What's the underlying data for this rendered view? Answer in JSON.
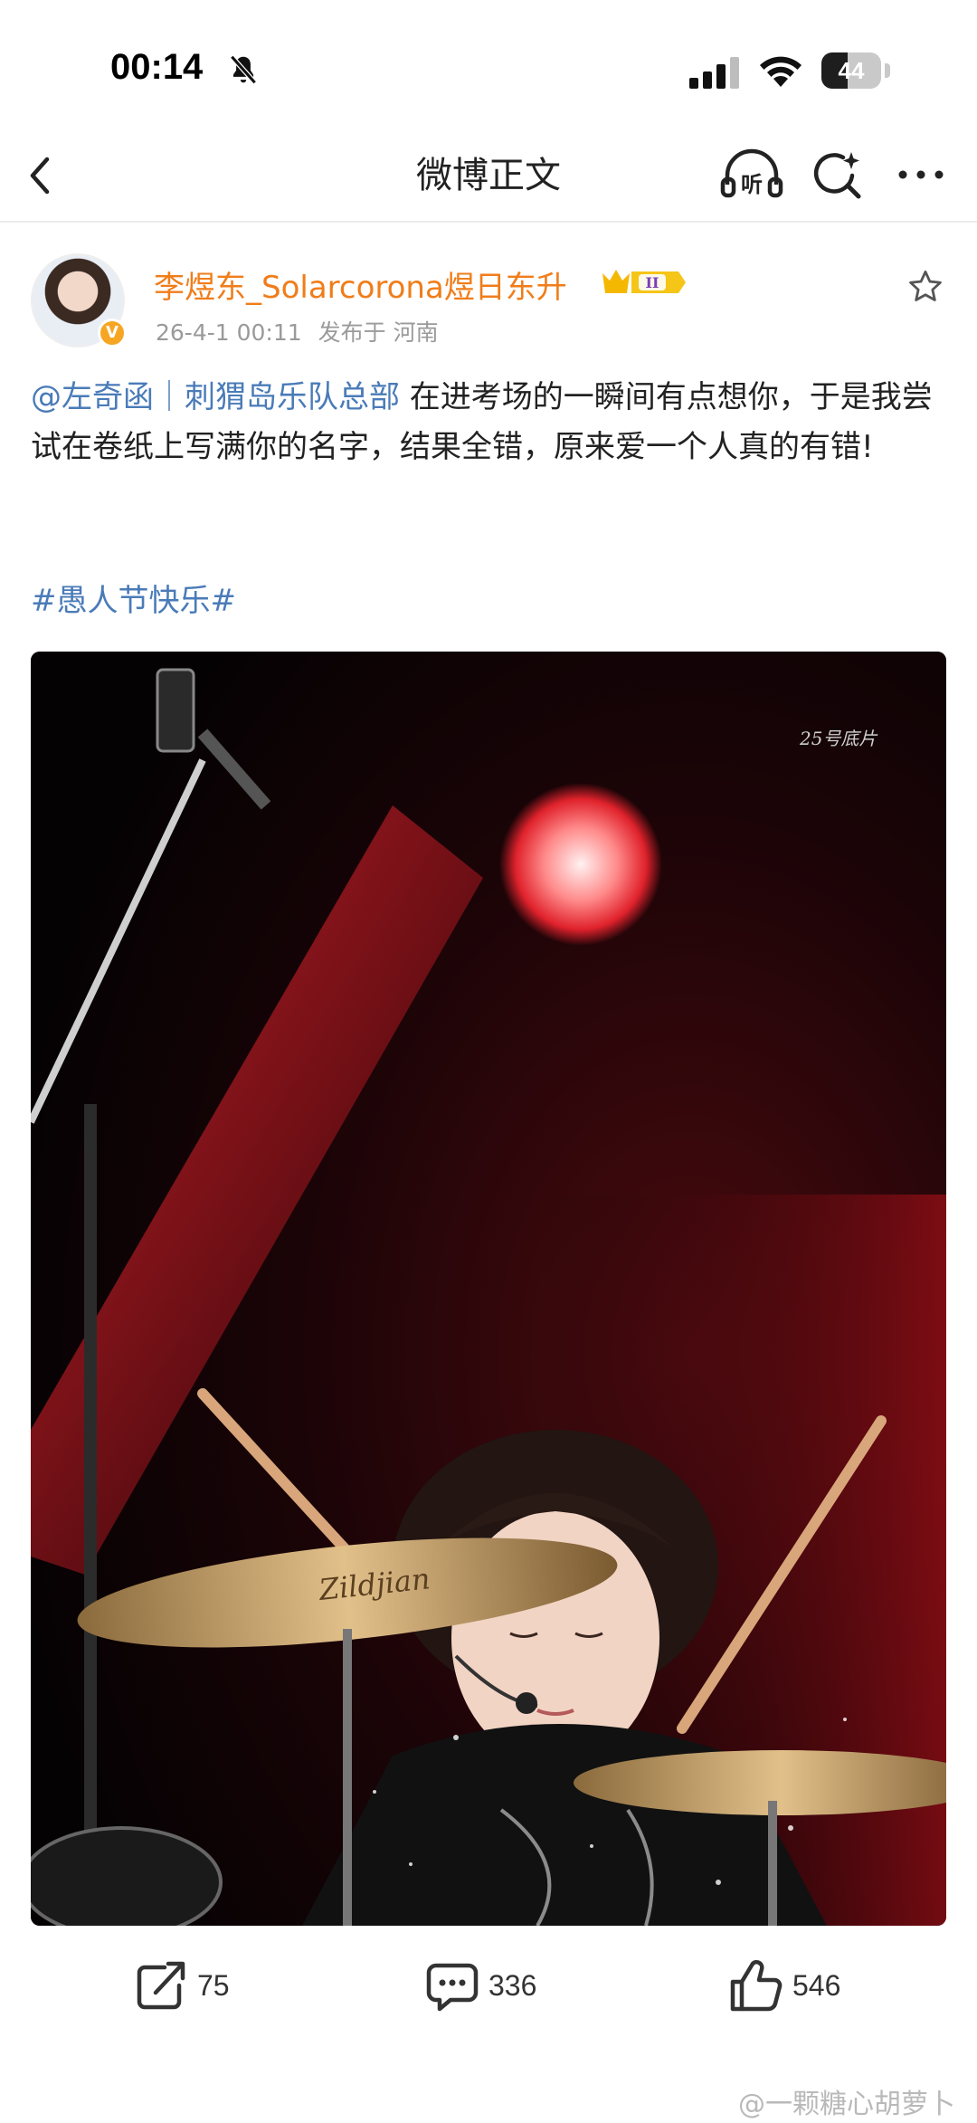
{
  "status_bar": {
    "time": "00:14",
    "battery": "44",
    "battery_level": 0.44,
    "icons": [
      "bell-mute-icon",
      "cellular-signal-icon",
      "wifi-icon",
      "battery-icon"
    ]
  },
  "nav": {
    "title": "微博正文",
    "listen_label": "听",
    "icons": [
      "back-icon",
      "listen-icon",
      "search-ai-icon",
      "more-icon"
    ]
  },
  "author": {
    "name": "李煜东_Solarcorona煜日东升",
    "vip_level": "II",
    "verified_mark": "V",
    "date": "26-4-1 00:11",
    "location": "发布于 河南"
  },
  "post": {
    "mention": "@左奇函｜刺猬岛乐队总部",
    "text": " 在进考场的一瞬间有点想你，于是我尝试在卷纸上写满你的名字，结果全错，原来爱一个人真的有错!",
    "hashtag": "#愚人节快乐#"
  },
  "photo": {
    "watermark": "25号底片",
    "cymbal_brand": "Zildjian"
  },
  "actions": {
    "repost_count": "75",
    "comment_count": "336",
    "like_count": "546"
  },
  "footer": {
    "watermark": "@一颗糖心胡萝卜"
  },
  "colors": {
    "author_name": "#f07d1a",
    "link_blue": "#4a7bb8",
    "meta_gray": "#9a9a9a",
    "vip_gold": "#f5b800"
  }
}
